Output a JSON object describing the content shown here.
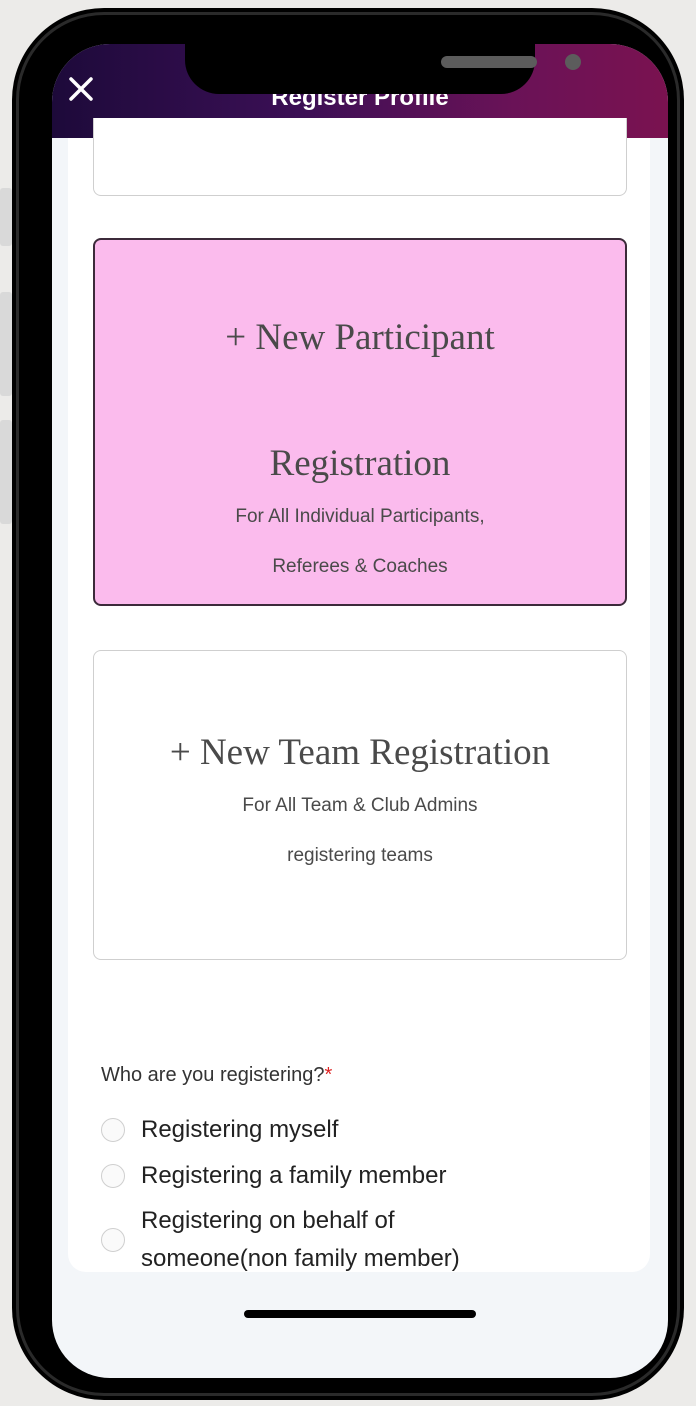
{
  "nav": {
    "title": "Register Profile",
    "close_icon": "close-icon"
  },
  "cards": {
    "participant": {
      "title_line1": "+ New Participant",
      "title_line2": "Registration",
      "subtitle_line1": "For All Individual Participants,",
      "subtitle_line2": "Referees & Coaches",
      "background": "#fbbbed"
    },
    "team": {
      "title": "+ New Team Registration",
      "subtitle_line1": "For All Team & Club Admins",
      "subtitle_line2": "registering teams"
    }
  },
  "question": {
    "label": "Who are you registering?",
    "required_mark": "*",
    "options": [
      {
        "label": "Registering myself"
      },
      {
        "label": "Registering a family member"
      },
      {
        "label_line1": "Registering on behalf of",
        "label_line2": "someone(non family member)"
      }
    ]
  },
  "theme": {
    "nav_gradient_start": "#1d0a3a",
    "nav_gradient_end": "#7a1250",
    "required_color": "#dd2222"
  }
}
